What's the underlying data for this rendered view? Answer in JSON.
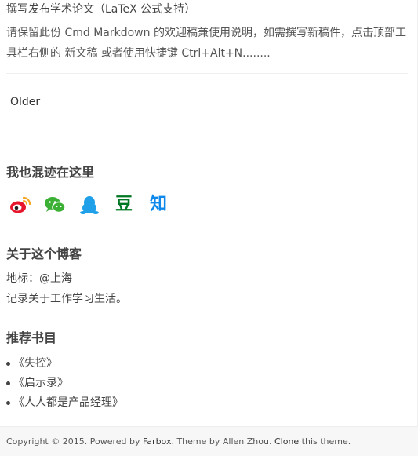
{
  "post": {
    "title": "撰写发布学术论文（LaTeX 公式支持）",
    "summary": "请保留此份 Cmd Markdown 的欢迎稿兼使用说明，如需撰写新稿件，点击顶部工具栏右侧的 新文稿 或者使用快捷键 Ctrl+Alt+N........"
  },
  "pagination": {
    "older_label": "Older"
  },
  "social_section": {
    "title": "我也混迹在这里",
    "items": [
      {
        "name": "weibo",
        "icon": "weibo-icon",
        "color": "#e6162d"
      },
      {
        "name": "wechat",
        "icon": "wechat-icon",
        "color": "#3cb034"
      },
      {
        "name": "qq",
        "icon": "qq-penguin-icon",
        "color": "#1fa0e8"
      },
      {
        "name": "douban",
        "glyph": "豆",
        "icon": "douban-icon",
        "color": "#007722"
      },
      {
        "name": "zhihu",
        "glyph": "知",
        "icon": "zhihu-icon",
        "color": "#0f88eb"
      }
    ]
  },
  "about_section": {
    "title": "关于这个博客",
    "location": "地标：@上海",
    "description": "记录关于工作学习生活。"
  },
  "books_section": {
    "title": "推荐书目",
    "items": [
      "《失控》",
      "《启示录》",
      "《人人都是产品经理》"
    ]
  },
  "footer": {
    "copyright": "Copyright © 2015. Powered by ",
    "farbox_link": "Farbox",
    "theme_text": ". Theme by Allen Zhou. ",
    "clone_link": "Clone",
    "tail_text": " this theme."
  }
}
